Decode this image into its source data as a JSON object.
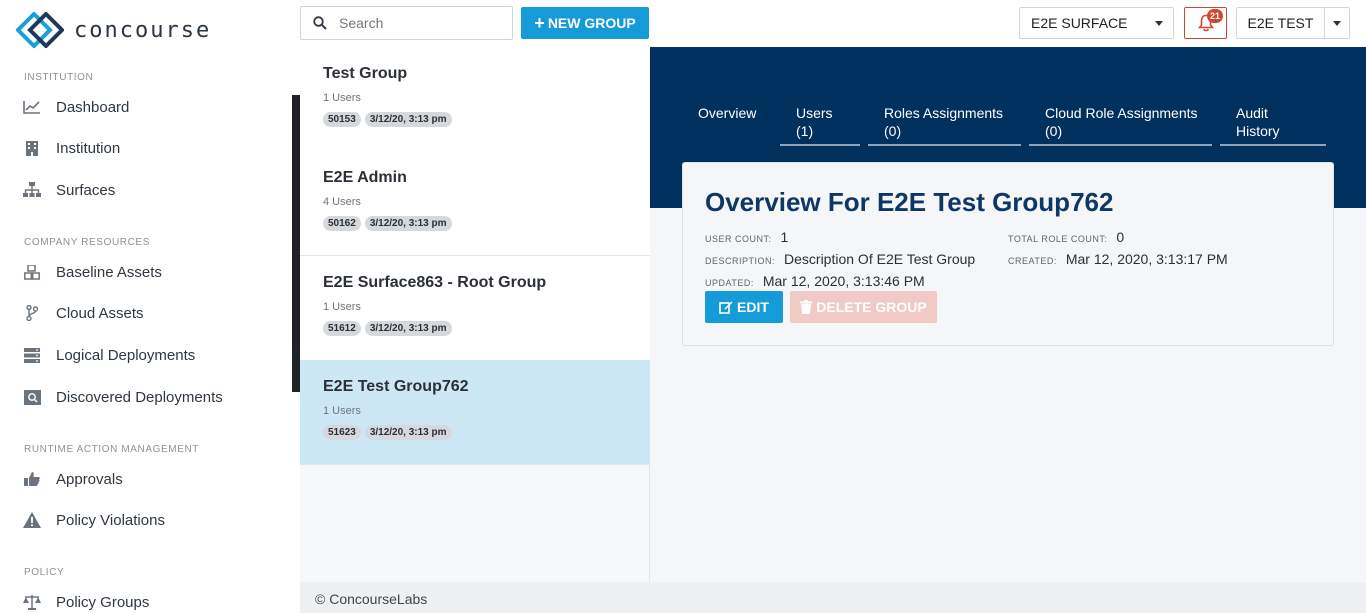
{
  "app": {
    "logo_text": "concourse"
  },
  "sidebar": {
    "sections": [
      {
        "title": "INSTITUTION",
        "items": [
          {
            "label": "Dashboard",
            "icon": "chart-line-icon"
          },
          {
            "label": "Institution",
            "icon": "building-icon"
          },
          {
            "label": "Surfaces",
            "icon": "sitemap-icon"
          }
        ]
      },
      {
        "title": "COMPANY RESOURCES",
        "items": [
          {
            "label": "Baseline Assets",
            "icon": "cubes-icon"
          },
          {
            "label": "Cloud Assets",
            "icon": "code-branch-icon"
          },
          {
            "label": "Logical Deployments",
            "icon": "server-icon"
          },
          {
            "label": "Discovered Deployments",
            "icon": "search-server-icon"
          }
        ]
      },
      {
        "title": "RUNTIME ACTION MANAGEMENT",
        "items": [
          {
            "label": "Approvals",
            "icon": "thumbs-up-icon"
          },
          {
            "label": "Policy Violations",
            "icon": "warning-icon"
          }
        ]
      },
      {
        "title": "POLICY",
        "items": [
          {
            "label": "Policy Groups",
            "icon": "balance-scale-icon"
          }
        ]
      }
    ]
  },
  "topbar": {
    "search_placeholder": "Search",
    "new_group_label": "NEW GROUP",
    "surface_select": "E2E SURFACE",
    "notification_count": "21",
    "user_name": "E2E TEST"
  },
  "groups": [
    {
      "name": "Test Group",
      "users": "1 Users",
      "id": "50153",
      "date": "3/12/20, 3:13 pm"
    },
    {
      "name": "E2E Admin",
      "users": "4 Users",
      "id": "50162",
      "date": "3/12/20, 3:13 pm"
    },
    {
      "name": "E2E Surface863 - Root Group",
      "users": "1 Users",
      "id": "51612",
      "date": "3/12/20, 3:13 pm"
    },
    {
      "name": "E2E Test Group762",
      "users": "1 Users",
      "id": "51623",
      "date": "3/12/20, 3:13 pm"
    }
  ],
  "detail": {
    "tabs": [
      {
        "line1": "Overview",
        "line2": ""
      },
      {
        "line1": "Users",
        "line2": "(1)"
      },
      {
        "line1": "Roles Assignments",
        "line2": "(0)"
      },
      {
        "line1": "Cloud Role Assignments",
        "line2": "(0)"
      },
      {
        "line1": "Audit",
        "line2": "History"
      }
    ],
    "title": "Overview For E2E Test Group762",
    "user_count_label": "USER COUNT:",
    "user_count": "1",
    "total_role_count_label": "TOTAL ROLE COUNT:",
    "total_role_count": "0",
    "description_label": "DESCRIPTION:",
    "description": "Description Of E2E Test Group",
    "created_label": "CREATED:",
    "created": "Mar 12, 2020, 3:13:17 PM",
    "updated_label": "UPDATED:",
    "updated": "Mar 12, 2020, 3:13:46 PM",
    "edit_label": "EDIT",
    "delete_label": "DELETE GROUP"
  },
  "footer": {
    "text": "© ConcourseLabs"
  },
  "colors": {
    "accent": "#159bd7",
    "header_bg": "#00305e",
    "selected_bg": "#cde8f5",
    "danger": "#d0472f"
  }
}
